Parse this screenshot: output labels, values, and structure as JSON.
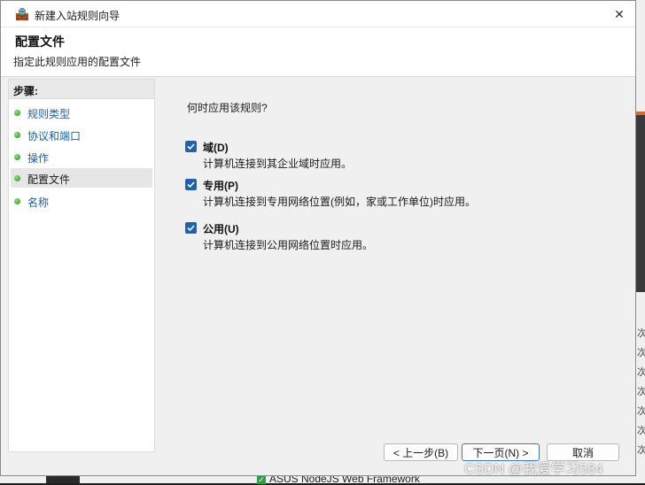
{
  "window": {
    "title": "新建入站规则向导",
    "close_glyph": "✕"
  },
  "header": {
    "title": "配置文件",
    "subtitle": "指定此规则应用的配置文件"
  },
  "steps": {
    "heading": "步骤:",
    "items": [
      {
        "label": "规则类型"
      },
      {
        "label": "协议和端口"
      },
      {
        "label": "操作"
      },
      {
        "label": "配置文件"
      },
      {
        "label": "名称"
      }
    ],
    "active_index": 3
  },
  "content": {
    "question": "何时应用该规则?",
    "options": [
      {
        "label": "域(D)",
        "description": "计算机连接到其企业域时应用。",
        "checked": true
      },
      {
        "label": "专用(P)",
        "description": "计算机连接到专用网络位置(例如，家或工作单位)时应用。",
        "checked": true
      },
      {
        "label": "公用(U)",
        "description": "计算机连接到公用网络位置时应用。",
        "checked": true
      }
    ]
  },
  "buttons": {
    "back": "< 上一步(B)",
    "next": "下一页(N) >",
    "cancel": "取消"
  },
  "background": {
    "bottom_text": "ASUS NodeJS Web Framework",
    "row_glyph": "次"
  },
  "watermark": "CSDN @我爱学习584",
  "colors": {
    "accent": "#1f62b3",
    "step_link": "#1b5fa8",
    "dot": "#3aa83a"
  }
}
